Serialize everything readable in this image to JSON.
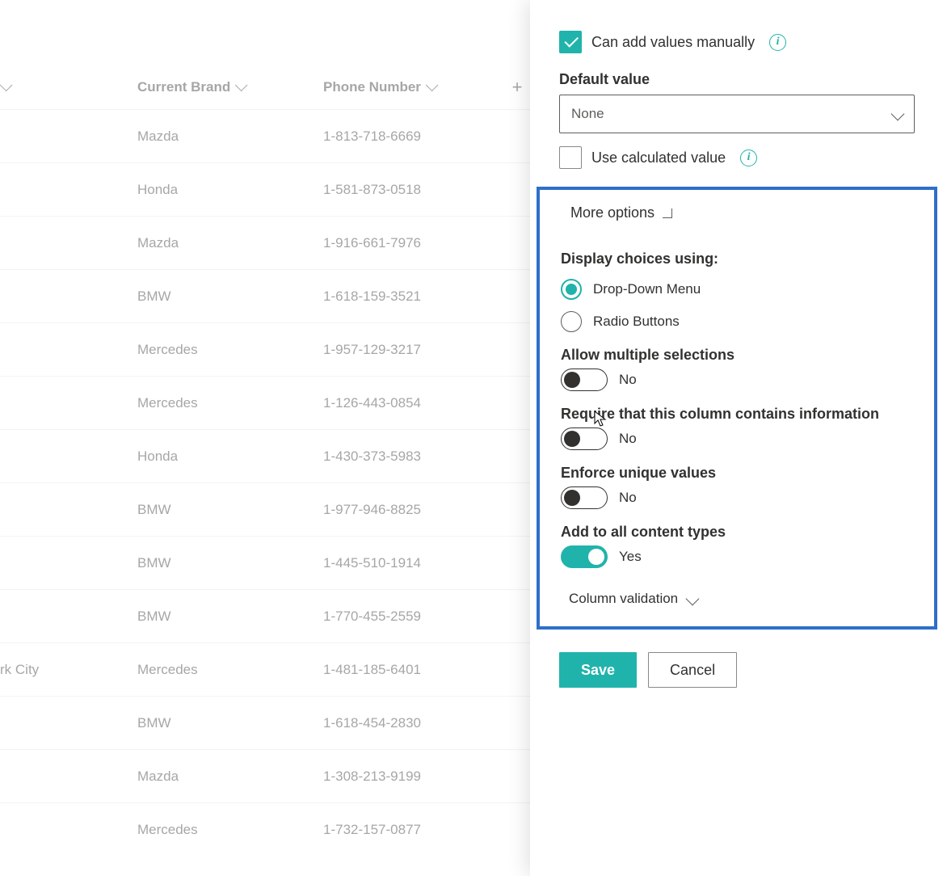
{
  "table": {
    "headers": {
      "city": "",
      "currentBrand": "Current Brand",
      "phone": "Phone Number"
    },
    "rows": [
      {
        "city": "",
        "brand": "Mazda",
        "phone": "1-813-718-6669"
      },
      {
        "city": "",
        "brand": "Honda",
        "phone": "1-581-873-0518"
      },
      {
        "city": "",
        "brand": "Mazda",
        "phone": "1-916-661-7976"
      },
      {
        "city": "",
        "brand": "BMW",
        "phone": "1-618-159-3521"
      },
      {
        "city": "",
        "brand": "Mercedes",
        "phone": "1-957-129-3217"
      },
      {
        "city": "",
        "brand": "Mercedes",
        "phone": "1-126-443-0854"
      },
      {
        "city": "",
        "brand": "Honda",
        "phone": "1-430-373-5983"
      },
      {
        "city": "",
        "brand": "BMW",
        "phone": "1-977-946-8825"
      },
      {
        "city": "",
        "brand": "BMW",
        "phone": "1-445-510-1914"
      },
      {
        "city": "",
        "brand": "BMW",
        "phone": "1-770-455-2559"
      },
      {
        "city": "rk City",
        "brand": "Mercedes",
        "phone": "1-481-185-6401"
      },
      {
        "city": "",
        "brand": "BMW",
        "phone": "1-618-454-2830"
      },
      {
        "city": "",
        "brand": "Mazda",
        "phone": "1-308-213-9199"
      },
      {
        "city": "",
        "brand": "Mercedes",
        "phone": "1-732-157-0877"
      }
    ]
  },
  "panel": {
    "canAddManually": {
      "label": "Can add values manually",
      "checked": true
    },
    "defaultValue": {
      "label": "Default value",
      "value": "None"
    },
    "useCalculated": {
      "label": "Use calculated value",
      "checked": false
    },
    "moreOptions": "More options",
    "displayChoices": {
      "label": "Display choices using:",
      "options": {
        "dropdown": "Drop-Down Menu",
        "radio": "Radio Buttons"
      },
      "selected": "dropdown"
    },
    "allowMultiple": {
      "label": "Allow multiple selections",
      "value": "No",
      "on": false
    },
    "requireInfo": {
      "label": "Require that this column contains information",
      "value": "No",
      "on": false
    },
    "enforceUnique": {
      "label": "Enforce unique values",
      "value": "No",
      "on": false
    },
    "addAllTypes": {
      "label": "Add to all content types",
      "value": "Yes",
      "on": true
    },
    "columnValidation": "Column validation",
    "buttons": {
      "save": "Save",
      "cancel": "Cancel"
    }
  }
}
